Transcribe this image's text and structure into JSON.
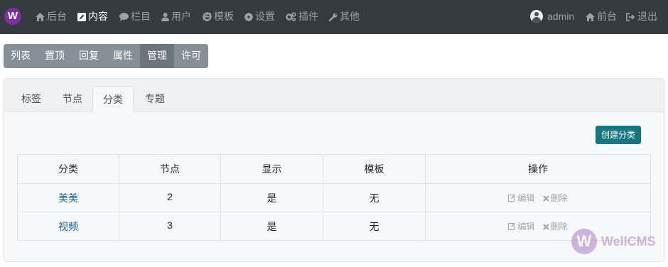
{
  "logo": {
    "letter": "W"
  },
  "nav": [
    {
      "label": "后台",
      "icon": "home-icon"
    },
    {
      "label": "内容",
      "icon": "edit-icon",
      "active": true
    },
    {
      "label": "栏目",
      "icon": "comment-icon"
    },
    {
      "label": "用户",
      "icon": "user-icon"
    },
    {
      "label": "模板",
      "icon": "ie-icon"
    },
    {
      "label": "设置",
      "icon": "gear-icon"
    },
    {
      "label": "插件",
      "icon": "cogs-icon"
    },
    {
      "label": "其他",
      "icon": "wrench-icon"
    }
  ],
  "user": {
    "name": "admin",
    "icon": "avatar-icon"
  },
  "right_nav": [
    {
      "label": "前台",
      "icon": "home-icon"
    },
    {
      "label": "退出",
      "icon": "sign-out-icon"
    }
  ],
  "button_group": [
    "列表",
    "置顶",
    "回复",
    "属性",
    "管理",
    "许可"
  ],
  "button_group_active": "管理",
  "tabs": [
    "标签",
    "节点",
    "分类",
    "专题"
  ],
  "tabs_active": "分类",
  "create_button": "创建分类",
  "table": {
    "headers": [
      "分类",
      "节点",
      "显示",
      "模板",
      "操作"
    ],
    "rows": [
      {
        "name": "美美",
        "nodes": "2",
        "display": "是",
        "template": "无",
        "edit": "编辑",
        "delete": "删除"
      },
      {
        "name": "视频",
        "nodes": "3",
        "display": "是",
        "template": "无",
        "edit": "编辑",
        "delete": "删除"
      }
    ]
  },
  "watermark": {
    "text": "WellCMS"
  },
  "colors": {
    "nav_bg": "#343a40",
    "accent": "#17777f",
    "link": "#1a5c86",
    "logo": "#7b2fa4"
  }
}
